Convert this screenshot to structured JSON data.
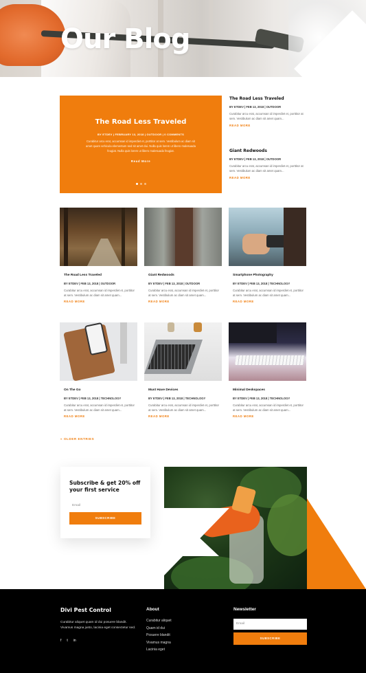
{
  "hero": {
    "title": "Our Blog"
  },
  "featured": {
    "title": "The Road Less Traveled",
    "meta": "BY ETDEV | FEBRUARY 13, 2018 | OUTDOOR | 0 COMMENTS",
    "excerpt": "Curabitur arcu erat, accumsan id imperdiet et, porttitor at sem. Vestibulum ac diam sit amet quam vehicula elementum sed sit amet dui. Nulla quis lorem ut libero malesuada feugiat. Nulla quis lorem ut libero malesuada feugiat.",
    "read_more": "Read More",
    "slider_dots": 3
  },
  "side_posts": [
    {
      "title": "The Road Less Traveled",
      "meta": "BY ETDEV | FEB 13, 2018 | OUTDOOR",
      "excerpt": "Curabitur arcu erat, accumsan id imperdiet et, porttitor at sem. Vestibulum ac diam sit amet quam...",
      "read_more": "READ MORE"
    },
    {
      "title": "Giant Redwoods",
      "meta": "BY ETDEV | FEB 13, 2018 | OUTDOOR",
      "excerpt": "Curabitur arcu erat, accumsan id imperdiet et, porttitor at sem. Vestibulum ac diam sit amet quam...",
      "read_more": "READ MORE"
    }
  ],
  "grid_posts": [
    {
      "title": "The Road Less Traveled",
      "meta": "BY ETDEV | FEB 13, 2018 | OUTDOOR",
      "excerpt": "Curabitur arcu erat, accumsan id imperdiet et, porttitor at sem. Vestibulum ac diam sit amet quam...",
      "read_more": "READ MORE",
      "image": "forest-road"
    },
    {
      "title": "Giant Redwoods",
      "meta": "BY ETDEV | FEB 13, 2018 | OUTDOOR",
      "excerpt": "Curabitur arcu erat, accumsan id imperdiet et, porttitor at sem. Vestibulum ac diam sit amet quam...",
      "read_more": "READ MORE",
      "image": "redwoods"
    },
    {
      "title": "Smartphone Photography",
      "meta": "BY ETDEV | FEB 13, 2018 | TECHNOLOGY",
      "excerpt": "Curabitur arcu erat, accumsan id imperdiet et, porttitor at sem. Vestibulum ac diam sit amet quam...",
      "read_more": "READ MORE",
      "image": "phone-photo"
    },
    {
      "title": "On The Go",
      "meta": "BY ETDEV | FEB 13, 2018 | TECHNOLOGY",
      "excerpt": "Curabitur arcu erat, accumsan id imperdiet et, porttitor at sem. Vestibulum ac diam sit amet quam...",
      "read_more": "READ MORE",
      "image": "phone-wallet"
    },
    {
      "title": "Must Have Devices",
      "meta": "BY ETDEV | FEB 13, 2018 | TECHNOLOGY",
      "excerpt": "Curabitur arcu erat, accumsan id imperdiet et, porttitor at sem. Vestibulum ac diam sit amet quam...",
      "read_more": "READ MORE",
      "image": "laptop"
    },
    {
      "title": "Minimal Deskspaces",
      "meta": "BY ETDEV | FEB 13, 2018 | TECHNOLOGY",
      "excerpt": "Curabitur arcu erat, accumsan id imperdiet et, porttitor at sem. Vestibulum ac diam sit amet quam...",
      "read_more": "READ MORE",
      "image": "keyboard"
    }
  ],
  "older_entries": "« OLDER ENTRIES",
  "subscribe": {
    "heading": "Subscribe & get 20% off your first service",
    "email_placeholder": "Email",
    "button": "SUBSCRIBE"
  },
  "footer": {
    "brand": "Divi Pest Control",
    "brand_text": "Curabitur aliquet quam id dui posuere blandit. Vivamus magna justo, lacinia eget consectetur sed.",
    "social": [
      "f",
      "t",
      "in"
    ],
    "about_heading": "About",
    "about_links": [
      "Curabitur aliquet",
      "Quam id dui",
      "Posuere blandit",
      "Vivamus magna",
      "Lacinia eget"
    ],
    "newsletter_heading": "Newsletter",
    "newsletter_placeholder": "Email",
    "newsletter_button": "SUBSCRIBE"
  },
  "colors": {
    "accent": "#f07d0d",
    "footer_bg": "#000000",
    "text_dark": "#111111"
  }
}
